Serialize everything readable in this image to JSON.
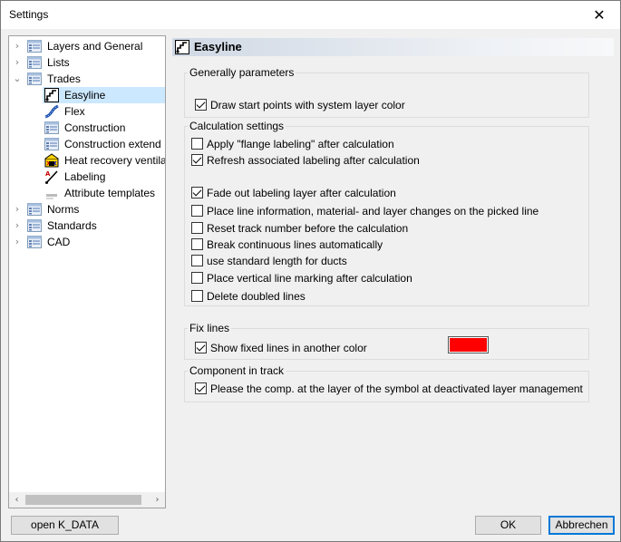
{
  "window": {
    "title": "Settings"
  },
  "tree": {
    "items": [
      {
        "label": "Layers and General",
        "expander": "›",
        "icon": "page-list-icon"
      },
      {
        "label": "Lists",
        "expander": "›",
        "icon": "page-list-icon"
      },
      {
        "label": "Trades",
        "expander": "⌄",
        "icon": "page-list-icon"
      },
      {
        "label": "Easyline",
        "icon": "easyline-icon"
      },
      {
        "label": "Flex",
        "icon": "flex-icon"
      },
      {
        "label": "Construction",
        "icon": "page-list-icon"
      },
      {
        "label": "Construction extend",
        "icon": "page-list-icon"
      },
      {
        "label": "Heat recovery ventila",
        "icon": "heat-recovery-icon"
      },
      {
        "label": "Labeling",
        "icon": "labeling-icon"
      },
      {
        "label": "Attribute templates",
        "icon": "attribute-template-icon"
      },
      {
        "label": "Norms",
        "expander": "›",
        "icon": "page-list-icon"
      },
      {
        "label": "Standards",
        "expander": "›",
        "icon": "page-list-icon"
      },
      {
        "label": "CAD",
        "expander": "›",
        "icon": "page-list-icon"
      }
    ],
    "selected": "Easyline"
  },
  "panel": {
    "title": "Easyline",
    "groups": {
      "general": {
        "label": "Generally parameters",
        "options": [
          {
            "label": "Draw start points with system layer color",
            "checked": true
          }
        ]
      },
      "calculation": {
        "label": "Calculation settings",
        "options": [
          {
            "label": "Apply \"flange labeling\" after calculation",
            "checked": false
          },
          {
            "label": "Refresh associated labeling after calculation",
            "checked": true
          },
          {
            "label": "Fade out labeling layer after calculation",
            "checked": true
          },
          {
            "label": "Place line information, material- and layer changes on the picked line",
            "checked": false
          },
          {
            "label": "Reset track number before the calculation",
            "checked": false
          },
          {
            "label": "Break continuous lines automatically",
            "checked": false
          },
          {
            "label": "use standard length for ducts",
            "checked": false
          },
          {
            "label": "Place vertical line marking after calculation",
            "checked": false
          },
          {
            "label": "Delete doubled lines",
            "checked": false
          }
        ]
      },
      "fix_lines": {
        "label": "Fix lines",
        "options": [
          {
            "label": "Show fixed lines in another color",
            "checked": true
          }
        ],
        "color": "#ff0000"
      },
      "component": {
        "label": "Component in track",
        "options": [
          {
            "label": "Please the comp. at the layer of the symbol at deactivated layer management",
            "checked": true
          }
        ]
      }
    }
  },
  "buttons": {
    "open_kdata": "open K_DATA",
    "ok": "OK",
    "cancel": "Abbrechen"
  },
  "icons": {
    "close": "✕",
    "scroll_left": "‹",
    "scroll_right": "›"
  }
}
